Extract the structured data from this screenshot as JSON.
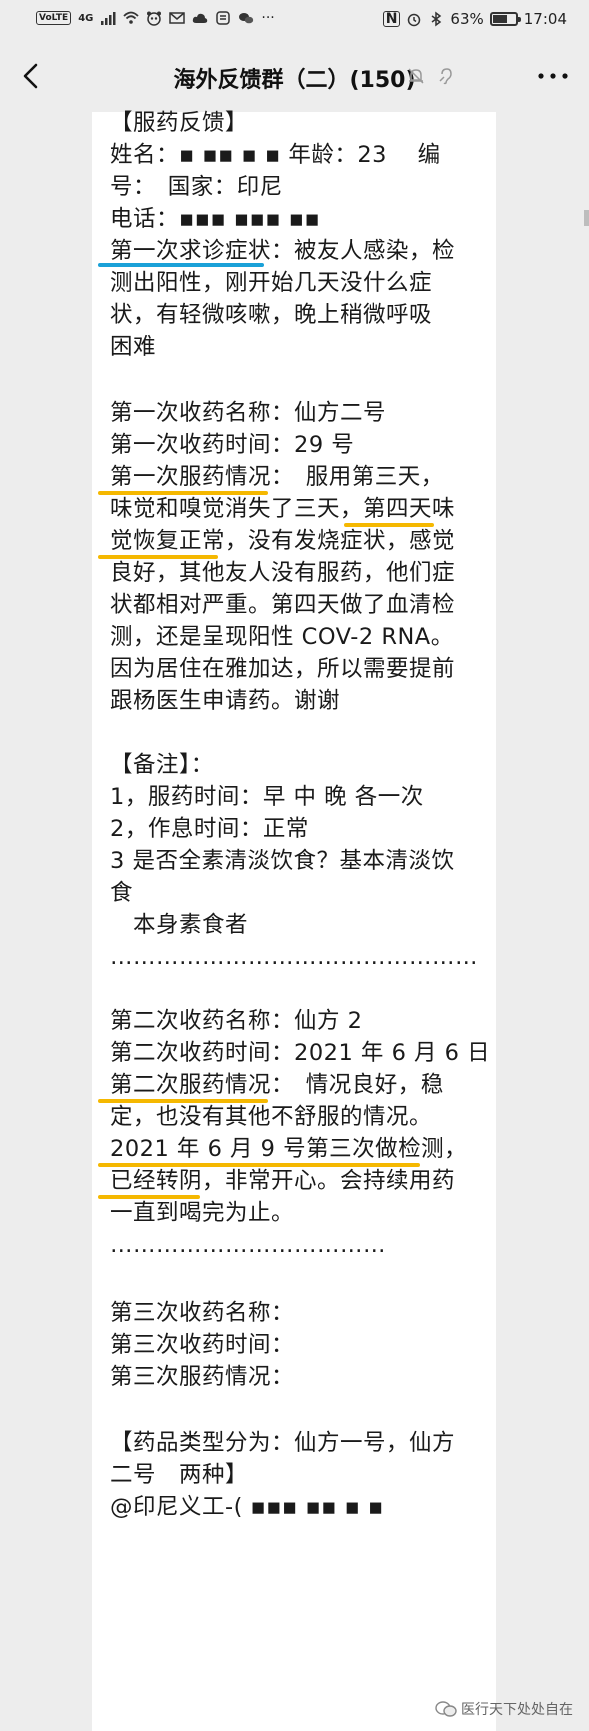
{
  "status_bar": {
    "volte": "VoLTE",
    "network": "4G",
    "battery": "63%",
    "battery_level": 0.63,
    "time": "17:04",
    "nfc": "N"
  },
  "header": {
    "title": "海外反馈群（二）(150)"
  },
  "message": {
    "lines": [
      "【服药反馈】",
      "姓名：▪ ▪▪ ▪ ▪  年龄：23　 编",
      "号：　国家：印尼",
      "电话：▪▪▪ ▪▪▪ ▪▪",
      "第一次求诊症状：被友人感染，检",
      "测出阳性，刚开始几天没什么症",
      "状，有轻微咳嗽，晚上稍微呼吸",
      "困难",
      "",
      "第一次收药名称：仙方二号",
      "第一次收药时间：29 号",
      "第一次服药情况：　服用第三天，",
      "味觉和嗅觉消失了三天，第四天味",
      "觉恢复正常，没有发烧症状，感觉",
      "良好，其他友人没有服药，他们症",
      "状都相对严重。第四天做了血清检",
      "测，还是呈现阳性 COV-2 RNA。",
      "因为居住在雅加达，所以需要提前",
      "跟杨医生申请药。谢谢",
      "",
      "【备注】：",
      "1，服药时间：早 中 晚 各一次",
      "2，作息时间：正常",
      "3 是否全素清淡饮食？基本清淡饮",
      "食",
      "　本身素食者",
      "…………………………………………",
      "",
      "第二次收药名称：仙方 2",
      "第二次收药时间：2021 年 6 月 6 日",
      "第二次服药情况：　情况良好，稳",
      "定，也没有其他不舒服的情况。",
      "2021 年 6 月 9 号第三次做检测，",
      "已经转阴，非常开心。会持续用药",
      "一直到喝完为止。",
      "………………………………",
      "",
      "第三次收药名称：",
      "第三次收药时间：",
      "第三次服药情况：",
      "",
      "【药品类型分为：仙方一号，仙方",
      "二号　两种】",
      "@印尼义工-( ▪▪▪ ▪▪ ▪ ▪"
    ],
    "underline_colors": {
      "blue": "#1aa1d8",
      "yellow": "#f5b800"
    }
  },
  "watermark": {
    "text": "医行天下处处自在"
  }
}
